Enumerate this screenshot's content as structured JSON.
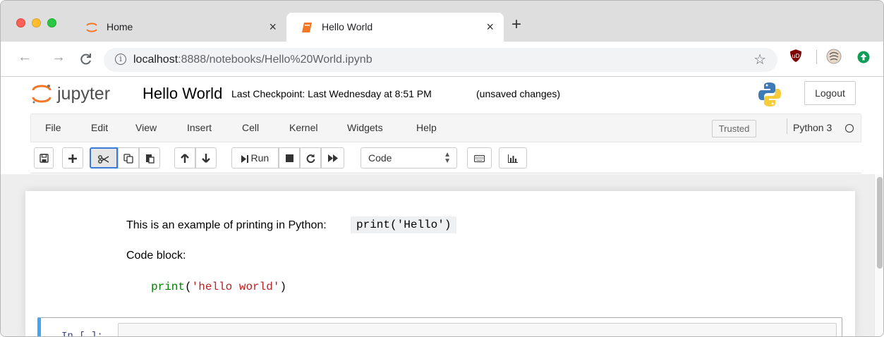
{
  "browser": {
    "tabs": [
      {
        "title": "Home",
        "icon": "jupyter-spinner-icon",
        "close": "×"
      },
      {
        "title": "Hello World",
        "icon": "notebook-icon",
        "close": "×",
        "active": true
      }
    ],
    "new_tab": "+",
    "nav": {
      "back": "←",
      "forward": "→",
      "reload": "C"
    },
    "url_host": "localhost",
    "url_path": ":8888/notebooks/Hello%20World.ipynb",
    "bookmark": "☆",
    "extensions": [
      "ublock-shield-icon",
      "profile-avatar-icon",
      "update-arrow-icon"
    ]
  },
  "jupyter": {
    "logo_text": "jupyter",
    "notebook_name": "Hello World",
    "checkpoint": "Last Checkpoint: Last Wednesday at 8:51 PM",
    "unsaved": "(unsaved changes)",
    "logout": "Logout"
  },
  "menu": {
    "items": [
      "File",
      "Edit",
      "View",
      "Insert",
      "Cell",
      "Kernel",
      "Widgets",
      "Help"
    ],
    "trusted": "Trusted",
    "kernel": "Python 3"
  },
  "toolbar": {
    "run_label": "Run",
    "cell_type": "Code",
    "active_button": "cut"
  },
  "notebook": {
    "markdown_text": "This is an example of printing in Python:",
    "inline_code": "print('Hello')",
    "code_block_label": "Code block:",
    "code_builtin": "print",
    "code_open": "(",
    "code_string": "'hello world'",
    "code_close": ")",
    "prompt": "In [ ]:"
  },
  "colors": {
    "tabbar_bg": "#dedede",
    "accent_blue": "#3b7bdc",
    "jupyter_orange": "#f37726",
    "cell_selected_border": "#42a5f5",
    "code_string": "#ba2121",
    "code_builtin": "#008000"
  }
}
